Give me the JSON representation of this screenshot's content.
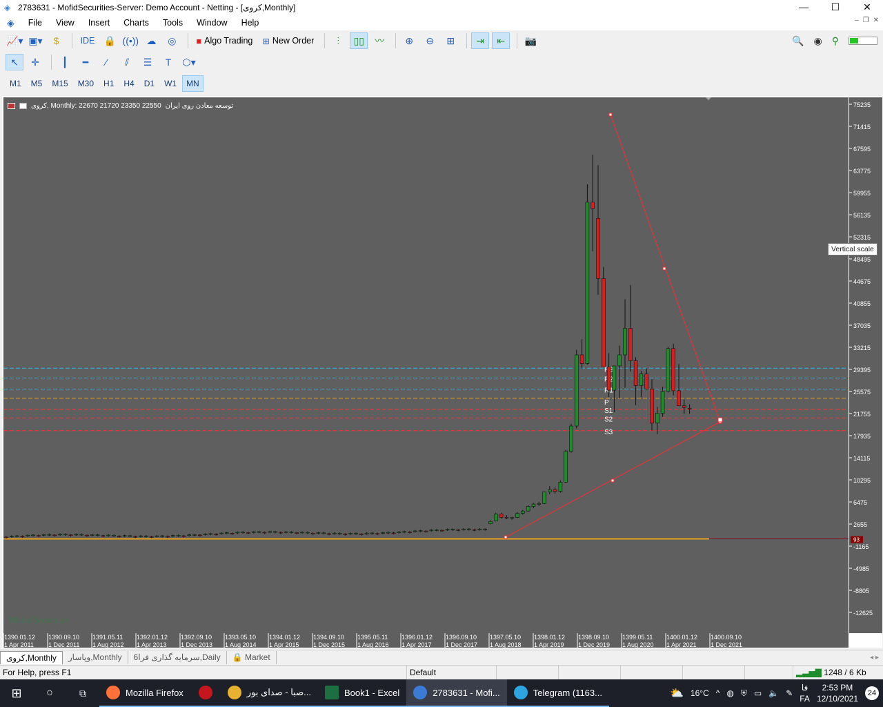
{
  "window": {
    "title": "2783631 - MofidSecurities-Server: Demo Account - Netting - [کروی,Monthly]",
    "controls": [
      "—",
      "☐",
      "✕"
    ]
  },
  "menu": [
    "File",
    "View",
    "Insert",
    "Charts",
    "Tools",
    "Window",
    "Help"
  ],
  "toolbar1": {
    "ide_label": "IDE",
    "algo_label": "Algo Trading",
    "order_label": "New Order"
  },
  "timeframes": [
    "M1",
    "M5",
    "M15",
    "M30",
    "H1",
    "H4",
    "D1",
    "W1",
    "MN"
  ],
  "selected_timeframe": "MN",
  "chart": {
    "symbol_header": "کروی, Monthly:  22670 21720 23350 22550",
    "description": "توسعه معادن روی ایران",
    "tooltip": "Vertical scale",
    "watermark": "Mofid Securities",
    "price_labels": [
      "75235",
      "71415",
      "67595",
      "63775",
      "59955",
      "56135",
      "52315",
      "48495",
      "44675",
      "40855",
      "37035",
      "33215",
      "29395",
      "25575",
      "21755",
      "17935",
      "14115",
      "10295",
      "6475",
      "2655",
      "-1165",
      "-4985",
      "-8805",
      "-12625"
    ],
    "price_badge": "93",
    "time_labels_top": [
      "1390.01.12",
      "1390.09.10",
      "1391.05.11",
      "1392.01.12",
      "1392.09.10",
      "1393.05.10",
      "1394.01.12",
      "1394.09.10",
      "1395.05.11",
      "1396.01.12",
      "1396.09.10",
      "1397.05.10",
      "1398.01.12",
      "1398.09.10",
      "1399.05.11",
      "1400.01.12",
      "1400.09.10"
    ],
    "time_labels_bottom": [
      "1 Apr 2011",
      "1 Dec 2011",
      "1 Aug 2012",
      "1 Apr 2013",
      "1 Dec 2013",
      "1 Aug 2014",
      "1 Apr 2015",
      "1 Dec 2015",
      "1 Aug 2016",
      "1 Apr 2017",
      "1 Dec 2017",
      "1 Aug 2018",
      "1 Apr 2019",
      "1 Dec 2019",
      "1 Aug 2020",
      "1 Apr 2021",
      "1 Dec 2021"
    ],
    "pivot_labels": [
      "R3",
      "R2",
      "R1",
      "P",
      "S1",
      "S2",
      "S3"
    ],
    "colors": {
      "bg": "#5f5f5f",
      "bull": "#1e8c2a",
      "bear": "#d61e1e",
      "line": "#ff2a2a"
    }
  },
  "tabs": [
    {
      "label": "کروی,Monthly",
      "active": true
    },
    {
      "label": "وپاسار,Monthly",
      "active": false
    },
    {
      "label": "سرمایه گذاری فرا6,Daily",
      "active": false
    },
    {
      "label": "Market",
      "active": false
    }
  ],
  "status": {
    "help": "For Help, press F1",
    "profile": "Default",
    "traffic": "1248 / 6 Kb"
  },
  "taskbar": {
    "apps": [
      {
        "label": "Mozilla Firefox",
        "color": "#ff7139"
      },
      {
        "label": "",
        "color": "#c4161c"
      },
      {
        "label": "صبا - صدای بور...",
        "color": "#e8b130"
      },
      {
        "label": "Book1 - Excel",
        "color": "#1d6f42"
      },
      {
        "label": "2783631 - Mofi...",
        "color": "#3a7bd5"
      },
      {
        "label": "Telegram (1163...",
        "color": "#2ca5e0"
      }
    ],
    "weather": "16°C",
    "lang_top": "فا",
    "lang_bottom": "FA",
    "time": "2:53 PM",
    "date": "12/10/2021",
    "notif_count": "24"
  }
}
